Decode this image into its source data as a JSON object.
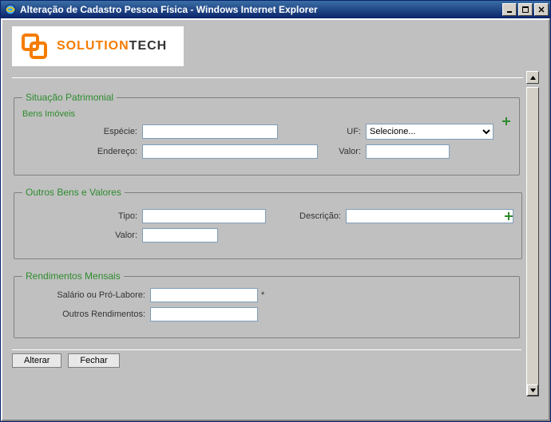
{
  "window": {
    "title": "Alteração de Cadastro Pessoa Física - Windows Internet Explorer"
  },
  "logo": {
    "brand_prefix": "SOLUTION",
    "brand_suffix": "TECH"
  },
  "section1": {
    "legend": "Situação Patrimonial",
    "subheader": "Bens Imóveis",
    "especie_label": "Espécie:",
    "especie_value": "",
    "uf_label": "UF:",
    "uf_selected": "Selecione...",
    "endereco_label": "Endereço:",
    "endereco_value": "",
    "valor_label": "Valor:",
    "valor_value": ""
  },
  "section2": {
    "legend": "Outros Bens e Valores",
    "tipo_label": "Tipo:",
    "tipo_value": "",
    "descricao_label": "Descrição:",
    "descricao_value": "",
    "valor_label": "Valor:",
    "valor_value": ""
  },
  "section3": {
    "legend": "Rendimentos Mensais",
    "salario_label": "Salário ou Pró-Labore:",
    "salario_value": "",
    "required_mark": "*",
    "outros_label": "Outros Rendimentos:",
    "outros_value": ""
  },
  "buttons": {
    "alterar": "Alterar",
    "fechar": "Fechar"
  }
}
